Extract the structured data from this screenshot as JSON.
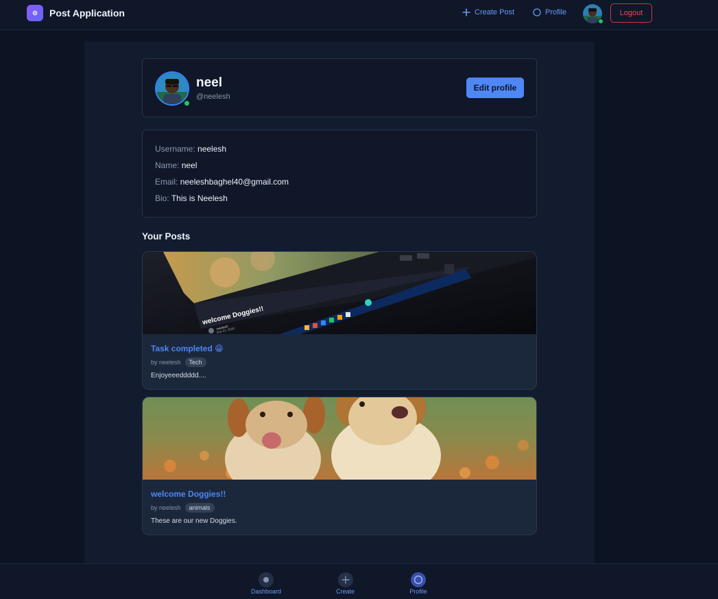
{
  "header": {
    "app_title": "Post Application",
    "create_post_label": "Create Post",
    "profile_label": "Profile",
    "logout_label": "Logout"
  },
  "profile": {
    "name": "neel",
    "handle": "@neelesh",
    "edit_label": "Edit profile",
    "online": true
  },
  "info": [
    {
      "label": "Username:",
      "value": "neelesh"
    },
    {
      "label": "Name:",
      "value": "neel"
    },
    {
      "label": "Email:",
      "value": "neeleshbaghel40@gmail.com"
    },
    {
      "label": "Bio:",
      "value": "This is Neelesh"
    }
  ],
  "posts_section_title": "Your Posts",
  "posts": [
    {
      "title": "Task completed 😁",
      "author": "by neelesh",
      "tag": "Tech",
      "body": "Enjoyeeeddddd....",
      "image_caption": "welcome Doggies!!",
      "image_author": "neelesh",
      "image_date": "Sep 21, 2025"
    },
    {
      "title": "welcome Doggies!!",
      "author": "by neelesh",
      "tag": "animals",
      "body": "These are our new Doggies."
    }
  ],
  "bottom_nav": [
    {
      "label": "Dashboard",
      "icon": "dot-icon"
    },
    {
      "label": "Create",
      "icon": "plus-icon"
    },
    {
      "label": "Profile",
      "icon": "circle-icon",
      "active": true
    }
  ],
  "colors": {
    "accent": "#4f87f5",
    "danger": "#ef4a53",
    "online": "#22c55e",
    "background": "#0c1322"
  }
}
